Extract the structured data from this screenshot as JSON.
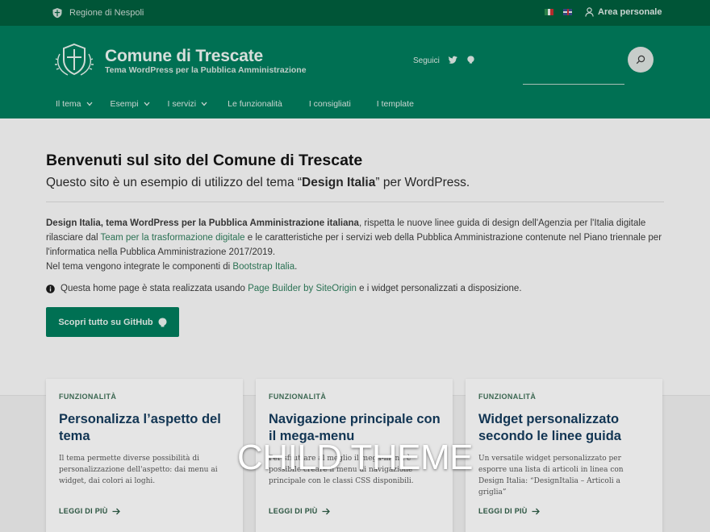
{
  "colors": {
    "brand": "#00795a",
    "brand_dark": "#005c3c",
    "card_title": "#143a5a",
    "link": "#2e7a5a"
  },
  "topbar": {
    "region": "Regione di Nespoli",
    "account": "Area personale",
    "languages": [
      "it",
      "en"
    ]
  },
  "header": {
    "site_name": "Comune di Trescate",
    "tagline": "Tema WordPress per la Pubblica Amministrazione",
    "follow_label": "Seguici",
    "social_icons": [
      "twitter-icon",
      "github-icon"
    ],
    "search": {
      "value": "",
      "placeholder": ""
    }
  },
  "nav": {
    "items": [
      {
        "label": "Il tema",
        "dropdown": true
      },
      {
        "label": "Esempi",
        "dropdown": true
      },
      {
        "label": "I servizi",
        "dropdown": true
      },
      {
        "label": "Le funzionalità",
        "dropdown": false
      },
      {
        "label": "I consigliati",
        "dropdown": false
      },
      {
        "label": "I template",
        "dropdown": false
      }
    ]
  },
  "main": {
    "title": "Benvenuti sul sito del Comune di Trescate",
    "subtitle_pre": "Questo sito è un esempio di utilizzo del tema “",
    "subtitle_bold": "Design Italia",
    "subtitle_post": "” per WordPress.",
    "intro_bold": "Design Italia, tema WordPress per la Pubblica Amministrazione italiana",
    "intro_1": ", rispetta le nuove linee guida di design dell'Agenzia per l'Italia digitale rilasciare dal ",
    "intro_link1": "Team per la trasformazione digitale",
    "intro_2": " e le caratteristiche per i servizi web della Pubblica Amministrazione contenute nel Piano triennale per l'informatica nella Pubblica Amministrazione 2017/2019.",
    "intro_3": "Nel tema vengono integrate le componenti di ",
    "intro_link2": "Bootstrap Italia",
    "intro_4": ".",
    "info_pre": "Questa home page è stata realizzata usando ",
    "info_link": "Page Builder by SiteOrigin",
    "info_post": " e i widget personalizzati a disposizione.",
    "github_button": "Scopri tutto su GitHub"
  },
  "cards": [
    {
      "kicker": "FUNZIONALITÀ",
      "title": "Personalizza l’aspetto del tema",
      "text": "Il tema permette diverse possibilità di personalizzazione dell'aspetto: dai menu ai widget, dai colori ai loghi.",
      "link": "LEGGI DI PIÙ"
    },
    {
      "kicker": "FUNZIONALITÀ",
      "title": "Navigazione principale con il mega-menu",
      "text": "Per sfruttare al meglio il mega-menu è possibile creare il menu di navigazione principale con le classi CSS disponibili.",
      "link": "LEGGI DI PIÙ"
    },
    {
      "kicker": "FUNZIONALITÀ",
      "title": "Widget personalizzato secondo le linee guida",
      "text": "Un versatile widget personalizzato per esporre una lista di articoli in linea con Design Italia: “DesignItalia – Articoli a griglia”",
      "link": "LEGGI DI PIÙ"
    }
  ],
  "watermark": "CHILD THEME"
}
